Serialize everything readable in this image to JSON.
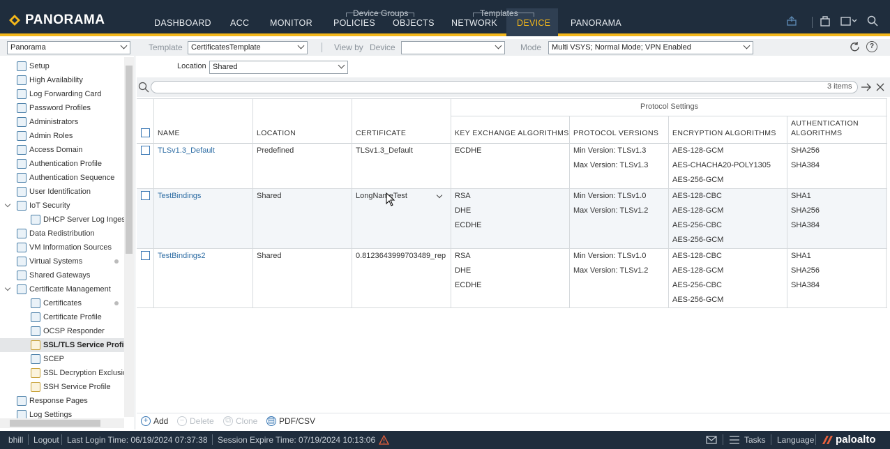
{
  "app": {
    "logo_text": "PANORAMA",
    "nav": [
      {
        "label": "DASHBOARD"
      },
      {
        "label": "ACC"
      },
      {
        "label": "MONITOR"
      },
      {
        "label": "POLICIES"
      },
      {
        "label": "OBJECTS"
      },
      {
        "label": "NETWORK"
      },
      {
        "label": "DEVICE"
      },
      {
        "label": "PANORAMA"
      }
    ],
    "nav_groups": {
      "device_groups": "Device Groups",
      "templates": "Templates"
    },
    "active_nav": "DEVICE",
    "accent_color": "#f3b71b"
  },
  "toolbar": {
    "context_select": "Panorama",
    "template_label": "Template",
    "template_value": "CertificatesTemplate",
    "view_by_label": "View by",
    "device_label": "Device",
    "device_value": "",
    "mode_label": "Mode",
    "mode_value": "Multi VSYS; Normal Mode; VPN Enabled"
  },
  "sidebar": {
    "items": [
      {
        "label": "Setup"
      },
      {
        "label": "High Availability"
      },
      {
        "label": "Log Forwarding Card"
      },
      {
        "label": "Password Profiles"
      },
      {
        "label": "Administrators"
      },
      {
        "label": "Admin Roles"
      },
      {
        "label": "Access Domain"
      },
      {
        "label": "Authentication Profile"
      },
      {
        "label": "Authentication Sequence"
      },
      {
        "label": "User Identification"
      },
      {
        "label": "IoT Security"
      },
      {
        "label": "DHCP Server Log Inges"
      },
      {
        "label": "Data Redistribution"
      },
      {
        "label": "VM Information Sources"
      },
      {
        "label": "Virtual Systems"
      },
      {
        "label": "Shared Gateways"
      },
      {
        "label": "Certificate Management"
      },
      {
        "label": "Certificates"
      },
      {
        "label": "Certificate Profile"
      },
      {
        "label": "OCSP Responder"
      },
      {
        "label": "SSL/TLS Service Profile"
      },
      {
        "label": "SCEP"
      },
      {
        "label": "SSL Decryption Exclusio"
      },
      {
        "label": "SSH Service Profile"
      },
      {
        "label": "Response Pages"
      },
      {
        "label": "Log Settings"
      }
    ],
    "selected": "SSL/TLS Service Profile"
  },
  "filter": {
    "location_label": "Location",
    "location_value": "Shared",
    "search_placeholder": "",
    "count": "3 items"
  },
  "table": {
    "group_header": "Protocol Settings",
    "columns": [
      "NAME",
      "LOCATION",
      "CERTIFICATE",
      "KEY EXCHANGE ALGORITHMS",
      "PROTOCOL VERSIONS",
      "ENCRYPTION ALGORITHMS",
      "AUTHENTICATION",
      "ALGORITHMS"
    ],
    "rows": [
      {
        "name": "TLSv1.3_Default",
        "location": "Predefined",
        "certificate": "TLSv1.3_Default",
        "kex": [
          "ECDHE"
        ],
        "versions": [
          "Min Version: TLSv1.3",
          "Max Version: TLSv1.3"
        ],
        "enc": [
          "AES-128-GCM",
          "AES-CHACHA20-POLY1305",
          "AES-256-GCM"
        ],
        "auth": [
          "SHA256",
          "SHA384"
        ]
      },
      {
        "name": "TestBindings",
        "location": "Shared",
        "certificate": "LongNameTest",
        "kex": [
          "RSA",
          "DHE",
          "ECDHE"
        ],
        "versions": [
          "Min Version: TLSv1.0",
          "Max Version: TLSv1.2"
        ],
        "enc": [
          "AES-128-CBC",
          "AES-128-GCM",
          "AES-256-CBC",
          "AES-256-GCM"
        ],
        "auth": [
          "SHA1",
          "SHA256",
          "SHA384"
        ]
      },
      {
        "name": "TestBindings2",
        "location": "Shared",
        "certificate": "0.8123643999703489_rep",
        "kex": [
          "RSA",
          "DHE",
          "ECDHE"
        ],
        "versions": [
          "Min Version: TLSv1.0",
          "Max Version: TLSv1.2"
        ],
        "enc": [
          "AES-128-CBC",
          "AES-128-GCM",
          "AES-256-CBC",
          "AES-256-GCM"
        ],
        "auth": [
          "SHA1",
          "SHA256",
          "SHA384"
        ]
      }
    ]
  },
  "actions": {
    "add": "Add",
    "delete": "Delete",
    "clone": "Clone",
    "pdf": "PDF/CSV"
  },
  "status": {
    "user": "bhill",
    "logout": "Logout",
    "last_login": "Last Login Time: 06/19/2024 07:37:38",
    "session_expire": "Session Expire Time: 07/19/2024 10:13:06",
    "tasks": "Tasks",
    "language": "Language",
    "brand": "paloalto"
  }
}
